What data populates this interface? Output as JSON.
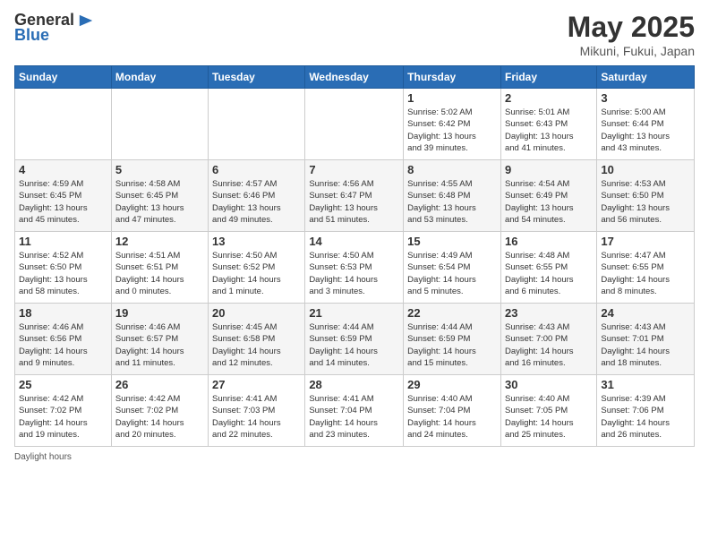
{
  "logo": {
    "general": "General",
    "blue": "Blue"
  },
  "header": {
    "month_title": "May 2025",
    "subtitle": "Mikuni, Fukui, Japan"
  },
  "days_of_week": [
    "Sunday",
    "Monday",
    "Tuesday",
    "Wednesday",
    "Thursday",
    "Friday",
    "Saturday"
  ],
  "weeks": [
    [
      {
        "day": "",
        "info": ""
      },
      {
        "day": "",
        "info": ""
      },
      {
        "day": "",
        "info": ""
      },
      {
        "day": "",
        "info": ""
      },
      {
        "day": "1",
        "info": "Sunrise: 5:02 AM\nSunset: 6:42 PM\nDaylight: 13 hours\nand 39 minutes."
      },
      {
        "day": "2",
        "info": "Sunrise: 5:01 AM\nSunset: 6:43 PM\nDaylight: 13 hours\nand 41 minutes."
      },
      {
        "day": "3",
        "info": "Sunrise: 5:00 AM\nSunset: 6:44 PM\nDaylight: 13 hours\nand 43 minutes."
      }
    ],
    [
      {
        "day": "4",
        "info": "Sunrise: 4:59 AM\nSunset: 6:45 PM\nDaylight: 13 hours\nand 45 minutes."
      },
      {
        "day": "5",
        "info": "Sunrise: 4:58 AM\nSunset: 6:45 PM\nDaylight: 13 hours\nand 47 minutes."
      },
      {
        "day": "6",
        "info": "Sunrise: 4:57 AM\nSunset: 6:46 PM\nDaylight: 13 hours\nand 49 minutes."
      },
      {
        "day": "7",
        "info": "Sunrise: 4:56 AM\nSunset: 6:47 PM\nDaylight: 13 hours\nand 51 minutes."
      },
      {
        "day": "8",
        "info": "Sunrise: 4:55 AM\nSunset: 6:48 PM\nDaylight: 13 hours\nand 53 minutes."
      },
      {
        "day": "9",
        "info": "Sunrise: 4:54 AM\nSunset: 6:49 PM\nDaylight: 13 hours\nand 54 minutes."
      },
      {
        "day": "10",
        "info": "Sunrise: 4:53 AM\nSunset: 6:50 PM\nDaylight: 13 hours\nand 56 minutes."
      }
    ],
    [
      {
        "day": "11",
        "info": "Sunrise: 4:52 AM\nSunset: 6:50 PM\nDaylight: 13 hours\nand 58 minutes."
      },
      {
        "day": "12",
        "info": "Sunrise: 4:51 AM\nSunset: 6:51 PM\nDaylight: 14 hours\nand 0 minutes."
      },
      {
        "day": "13",
        "info": "Sunrise: 4:50 AM\nSunset: 6:52 PM\nDaylight: 14 hours\nand 1 minute."
      },
      {
        "day": "14",
        "info": "Sunrise: 4:50 AM\nSunset: 6:53 PM\nDaylight: 14 hours\nand 3 minutes."
      },
      {
        "day": "15",
        "info": "Sunrise: 4:49 AM\nSunset: 6:54 PM\nDaylight: 14 hours\nand 5 minutes."
      },
      {
        "day": "16",
        "info": "Sunrise: 4:48 AM\nSunset: 6:55 PM\nDaylight: 14 hours\nand 6 minutes."
      },
      {
        "day": "17",
        "info": "Sunrise: 4:47 AM\nSunset: 6:55 PM\nDaylight: 14 hours\nand 8 minutes."
      }
    ],
    [
      {
        "day": "18",
        "info": "Sunrise: 4:46 AM\nSunset: 6:56 PM\nDaylight: 14 hours\nand 9 minutes."
      },
      {
        "day": "19",
        "info": "Sunrise: 4:46 AM\nSunset: 6:57 PM\nDaylight: 14 hours\nand 11 minutes."
      },
      {
        "day": "20",
        "info": "Sunrise: 4:45 AM\nSunset: 6:58 PM\nDaylight: 14 hours\nand 12 minutes."
      },
      {
        "day": "21",
        "info": "Sunrise: 4:44 AM\nSunset: 6:59 PM\nDaylight: 14 hours\nand 14 minutes."
      },
      {
        "day": "22",
        "info": "Sunrise: 4:44 AM\nSunset: 6:59 PM\nDaylight: 14 hours\nand 15 minutes."
      },
      {
        "day": "23",
        "info": "Sunrise: 4:43 AM\nSunset: 7:00 PM\nDaylight: 14 hours\nand 16 minutes."
      },
      {
        "day": "24",
        "info": "Sunrise: 4:43 AM\nSunset: 7:01 PM\nDaylight: 14 hours\nand 18 minutes."
      }
    ],
    [
      {
        "day": "25",
        "info": "Sunrise: 4:42 AM\nSunset: 7:02 PM\nDaylight: 14 hours\nand 19 minutes."
      },
      {
        "day": "26",
        "info": "Sunrise: 4:42 AM\nSunset: 7:02 PM\nDaylight: 14 hours\nand 20 minutes."
      },
      {
        "day": "27",
        "info": "Sunrise: 4:41 AM\nSunset: 7:03 PM\nDaylight: 14 hours\nand 22 minutes."
      },
      {
        "day": "28",
        "info": "Sunrise: 4:41 AM\nSunset: 7:04 PM\nDaylight: 14 hours\nand 23 minutes."
      },
      {
        "day": "29",
        "info": "Sunrise: 4:40 AM\nSunset: 7:04 PM\nDaylight: 14 hours\nand 24 minutes."
      },
      {
        "day": "30",
        "info": "Sunrise: 4:40 AM\nSunset: 7:05 PM\nDaylight: 14 hours\nand 25 minutes."
      },
      {
        "day": "31",
        "info": "Sunrise: 4:39 AM\nSunset: 7:06 PM\nDaylight: 14 hours\nand 26 minutes."
      }
    ]
  ],
  "footer": {
    "daylight_label": "Daylight hours"
  }
}
